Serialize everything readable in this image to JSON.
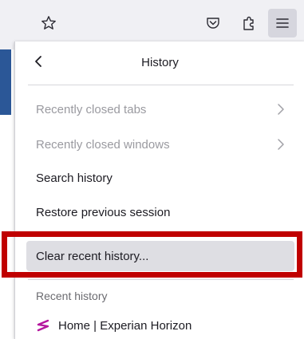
{
  "toolbar": {
    "icons": [
      "star-icon",
      "pocket-icon",
      "extensions-icon",
      "menu-icon"
    ]
  },
  "panel": {
    "title": "History",
    "back_icon": "chevron-left-icon",
    "items": [
      {
        "label": "Recently closed tabs",
        "disabled": true,
        "has_submenu": true
      },
      {
        "label": "Recently closed windows",
        "disabled": true,
        "has_submenu": true
      },
      {
        "label": "Search history",
        "disabled": false,
        "has_submenu": false
      },
      {
        "label": "Restore previous session",
        "disabled": false,
        "has_submenu": false
      },
      {
        "label": "Clear recent history...",
        "disabled": false,
        "has_submenu": false
      }
    ],
    "recent_label": "Recent history",
    "recent_entries": [
      {
        "title": "Home | Experian Horizon",
        "favicon": "experian-logo-icon"
      }
    ]
  },
  "colors": {
    "highlight_border": "#c00000",
    "toolbar_bg": "#f0f0f4",
    "accent_blue": "#2b5797",
    "favicon_magenta": "#b5179e"
  }
}
